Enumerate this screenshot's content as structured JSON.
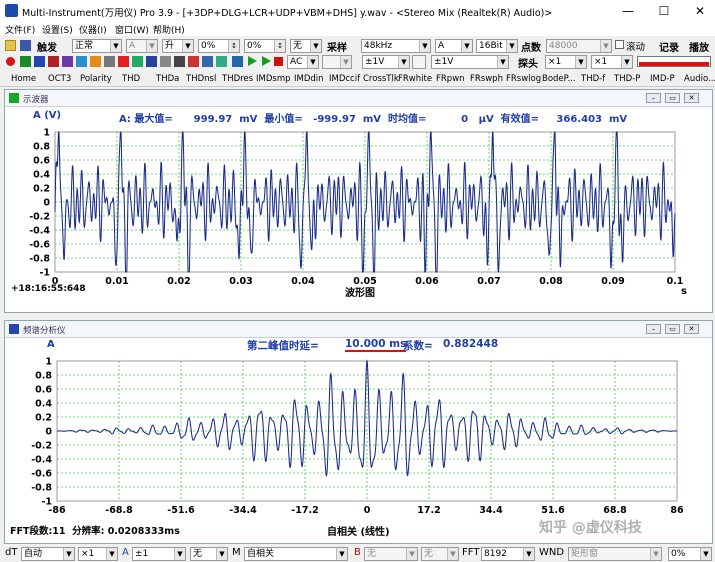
{
  "window": {
    "title": "Multi-Instrument(万用仪) Pro 3.9  -  [+3DP+DLG+LCR+UDP+VBM+DHS]   y.wav  -  <Stereo Mix (Realtek(R) Audio)>",
    "min": "—",
    "max": "☐",
    "close": "✕"
  },
  "menu": [
    "文件(F)",
    "设置(S)",
    "仪器(I)",
    "窗口(W)",
    "帮助(H)"
  ],
  "toolbar1": {
    "trigger_label": "触发",
    "trigger_mode": "正常",
    "channel": "A",
    "edge": "升",
    "pct1": "0%",
    "pct2": "0%",
    "none": "无",
    "sample_label": "采样",
    "rate": "48kHz",
    "channel2": "A",
    "bits": "16Bit",
    "points_label": "点数",
    "points": "48000",
    "scroll_label": "滚动",
    "record_label": "记录",
    "play_label": "播放"
  },
  "toolbar2": {
    "ac1": "AC",
    "range1": "±1V",
    "range2": "±1V",
    "probe_label": "探头",
    "probe1": "×1",
    "probe2": "×1"
  },
  "tabs": [
    "Home",
    "OCT3",
    "Polarity",
    "THD",
    "THDa",
    "THDnsl",
    "THDres",
    "IMDsmp",
    "IMDdin",
    "IMDccif",
    "CrossTlk",
    "FRwhite",
    "FRpwn",
    "FRswph",
    "FRswlog",
    "BodeP...",
    "THD-f",
    "THD-P",
    "IMD-P",
    "Audio..."
  ],
  "scope": {
    "title": "示波器",
    "unit": "A (V)",
    "stats": "A: 最大值=      999.97  mV  最小值=   -999.97  mV  时均值=          0   μV  有效值=     366.403  mV",
    "mi": "Mi",
    "time": "+18:16:55:648",
    "xunit": "s",
    "xname": "波形图"
  },
  "spectrum": {
    "title": "频谱分析仪",
    "chan": "A",
    "delay_label": "第二峰值时延=",
    "delay_value": "10.000 ms",
    "coef_label": "系数=",
    "coef_value": "0.882448",
    "mi": "Mi",
    "fft_info": "FFT段数:11  分辨率: 0.0208333ms",
    "xname": "自相关 (线性)",
    "watermark": "知乎 @虚仪科技"
  },
  "bottombar": {
    "dt_label": "dT",
    "dt": "自动",
    "x1": "×1",
    "a_label": "A",
    "a_range": "±1",
    "none1": "无",
    "m_label": "M",
    "m_mode": "自相关",
    "b_label": "B",
    "b_none": "无",
    "b_none2": "无",
    "fft_label": "FFT",
    "fft": "8192",
    "wnd_label": "WND",
    "wnd": "矩形窗",
    "pct": "0%"
  },
  "chart_data": [
    {
      "type": "line",
      "title": "波形图",
      "ylabel": "A (V)",
      "xlabel": "s",
      "xlim": [
        0,
        0.1
      ],
      "ylim": [
        -1,
        1
      ],
      "x_ticks": [
        "0",
        "0.01",
        "0.02",
        "0.03",
        "0.04",
        "0.05",
        "0.06",
        "0.07",
        "0.08",
        "0.09",
        "0.1"
      ],
      "y_ticks": [
        "1",
        "0.8",
        "0.6",
        "0.4",
        "0.2",
        "0",
        "-0.2",
        "-0.4",
        "-0.6",
        "-0.8",
        "-1"
      ],
      "series": [
        {
          "period": 0.01,
          "peak_offset": 0.0006,
          "x": [
            0,
            0.0006,
            0.0015,
            0.0025,
            0.0035,
            0.005,
            0.0065,
            0.0075,
            0.0085,
            0.0095,
            0.01
          ],
          "y": [
            0.2,
            1.0,
            -0.85,
            0.45,
            -0.4,
            0.35,
            -0.45,
            0.4,
            -0.6,
            -0.95,
            0.2
          ]
        }
      ],
      "grid": true,
      "color": "#1a2a8a"
    },
    {
      "type": "line",
      "title": "自相关 (线性)",
      "xlim": [
        -86,
        86
      ],
      "ylim": [
        -1,
        1
      ],
      "x_ticks": [
        "-86",
        "-68.8",
        "-51.6",
        "-34.4",
        "-17.2",
        "0",
        "17.2",
        "34.4",
        "51.6",
        "68.8",
        "86"
      ],
      "y_ticks": [
        "1",
        "0.8",
        "0.6",
        "0.4",
        "0.2",
        "0",
        "-0.2",
        "-0.4",
        "-0.6",
        "-0.8",
        "-1"
      ],
      "series": [
        {
          "x": [
            -86,
            -60,
            -40,
            -30,
            -20,
            -10,
            0,
            10,
            20,
            30,
            40,
            60,
            86
          ],
          "y": [
            0.0,
            0.08,
            0.3,
            0.5,
            0.6,
            0.88,
            1.0,
            0.88,
            0.6,
            0.5,
            0.3,
            0.08,
            0.0
          ]
        }
      ],
      "grid": true,
      "color": "#1a2a8a"
    }
  ],
  "colors": {
    "trace": "#1a2a8a",
    "grid": "#44cc44",
    "label": "#1f3ea8",
    "accent_red": "#cc0000"
  }
}
